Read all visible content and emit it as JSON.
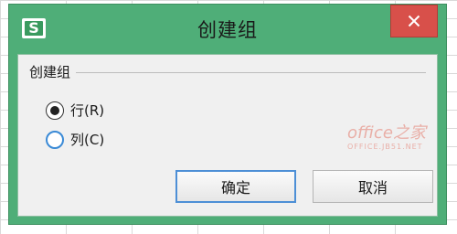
{
  "dialog": {
    "title": "创建组",
    "app_icon_letter": "S",
    "close_icon": "close-icon"
  },
  "group": {
    "title": "创建组",
    "options": [
      {
        "label": "行(R)",
        "checked": true
      },
      {
        "label": "列(C)",
        "checked": false
      }
    ]
  },
  "buttons": {
    "ok_label": "确定",
    "cancel_label": "取消"
  },
  "watermark": {
    "main": "office之家",
    "sub": "OFFICE.JB51.NET"
  },
  "colors": {
    "frame": "#4fae78",
    "close": "#d8504a",
    "client": "#f0f0f0",
    "focus": "#4d8fd6"
  }
}
